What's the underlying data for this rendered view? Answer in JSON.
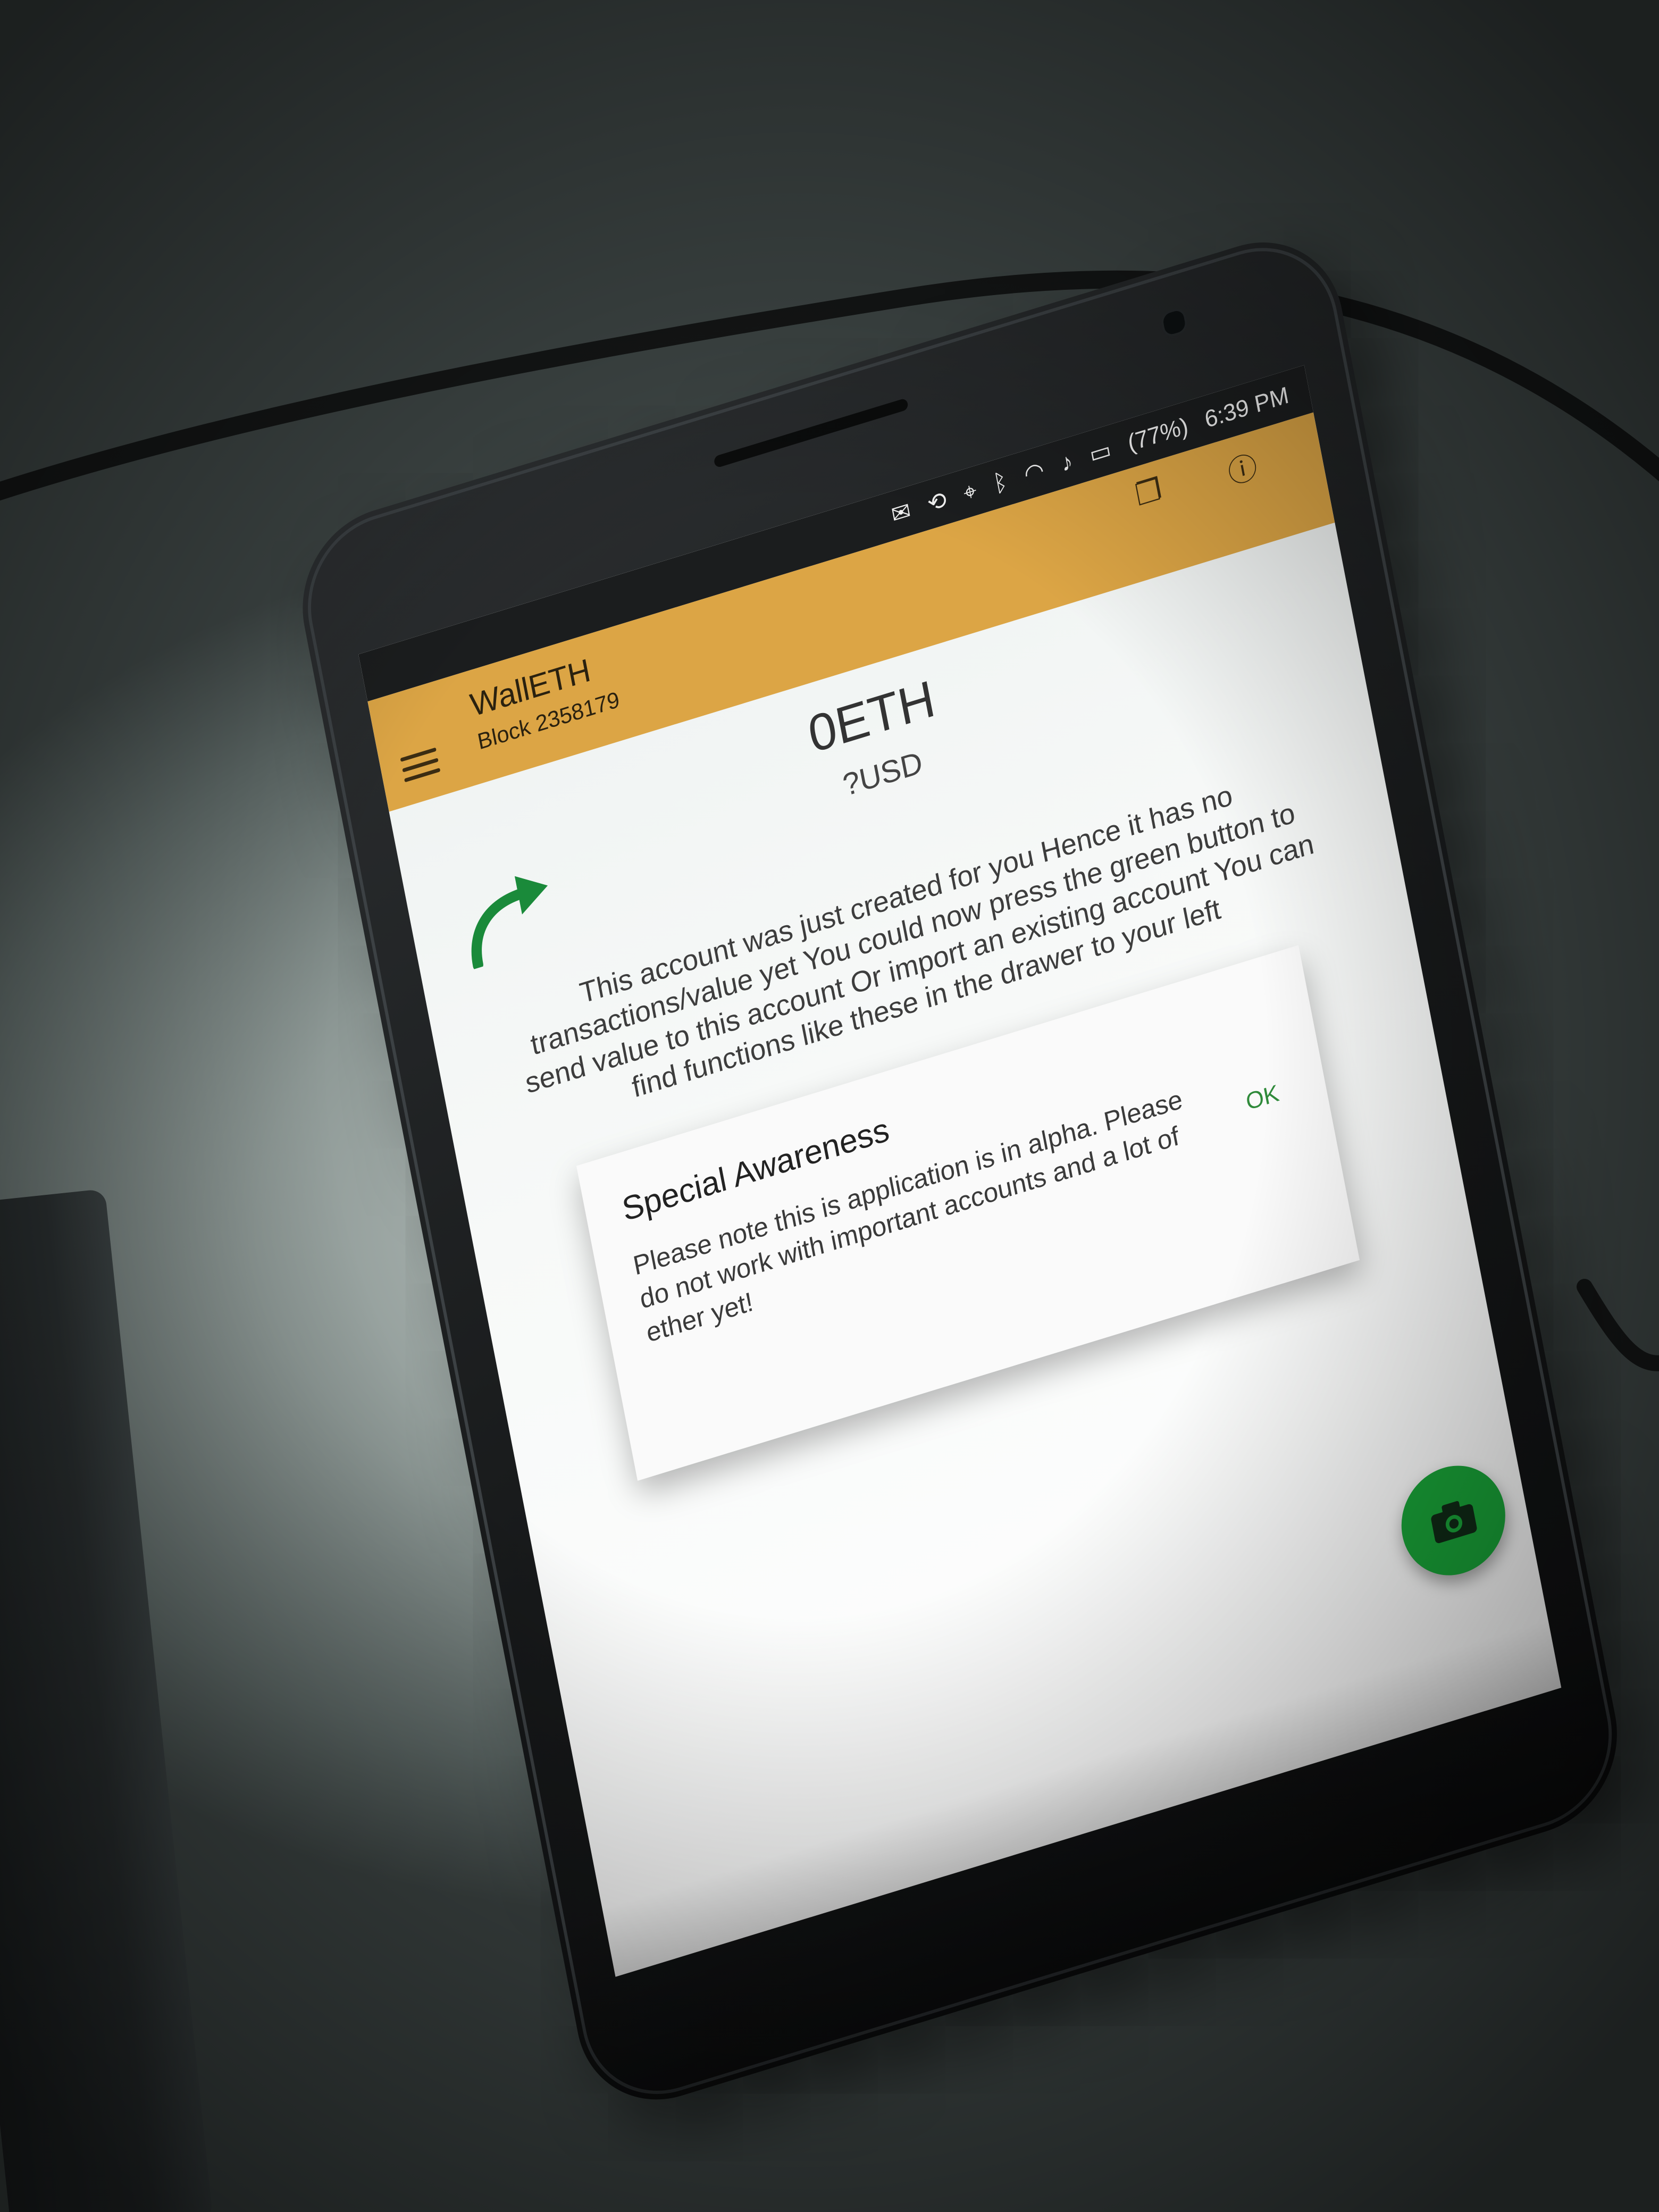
{
  "status_bar": {
    "battery_text": "(77%)",
    "time": "6:39 PM",
    "icons": [
      "mail-icon",
      "rotation-lock-icon",
      "location-icon",
      "bluetooth-icon",
      "wifi-icon",
      "volume-icon",
      "battery-icon"
    ]
  },
  "toolbar": {
    "title": "WallETH",
    "subtitle": "Block 2358179",
    "background_color": "#dca545",
    "icons": [
      "menu-icon",
      "copy-icon",
      "info-icon"
    ]
  },
  "account": {
    "balance": "0ETH",
    "fiat": "?USD",
    "message": "This account was just created for you Hence it has no transactions/value yet You could now press the green button to send value to this account Or import an existing account You can find functions like these in the drawer to your left"
  },
  "dialog": {
    "title": "Special Awareness",
    "body": "Please note this is application is in alpha. Please do not work with important accounts and a lot of ether yet!",
    "ok_label": "OK",
    "ok_color": "#2f8a3a"
  },
  "fab": {
    "icon": "camera-icon",
    "color": "#19a338"
  }
}
